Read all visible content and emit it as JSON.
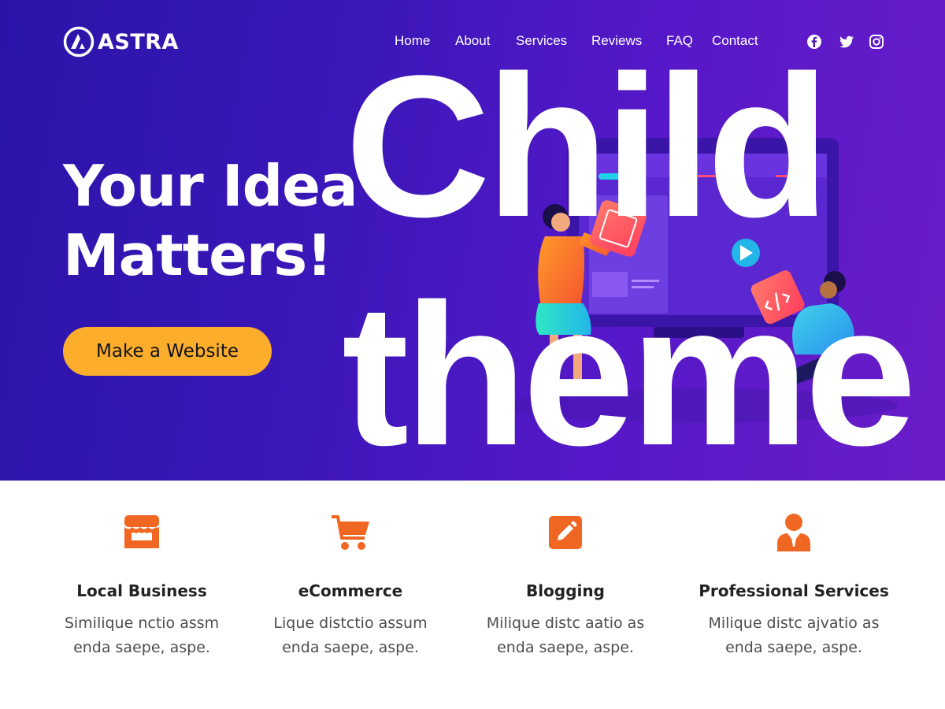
{
  "brand": {
    "name": "ASTRA"
  },
  "nav": {
    "items": [
      {
        "label": "Home"
      },
      {
        "label": "About"
      },
      {
        "label": "Services"
      },
      {
        "label": "Reviews"
      },
      {
        "label": "FAQ"
      },
      {
        "label": "Contact"
      }
    ]
  },
  "social": [
    "facebook-icon",
    "twitter-icon",
    "instagram-icon"
  ],
  "hero": {
    "headline_line1": "Your Idea",
    "headline_line2": "Matters!",
    "cta_label": "Make a Website"
  },
  "overlay": {
    "line1": "Child",
    "line2": "theme"
  },
  "features": [
    {
      "icon": "store-icon",
      "title": "Local Business",
      "desc_line1": "Similique nctio assm",
      "desc_line2": "enda saepe, aspe."
    },
    {
      "icon": "cart-icon",
      "title": "eCommerce",
      "desc_line1": "Lique distctio assum",
      "desc_line2": "enda saepe, aspe."
    },
    {
      "icon": "edit-icon",
      "title": "Blogging",
      "desc_line1": "Milique distc aatio as",
      "desc_line2": "enda saepe, aspe."
    },
    {
      "icon": "person-tie-icon",
      "title": "Professional Services",
      "desc_line1": "Milique distc ajvatio as",
      "desc_line2": "enda saepe, aspe."
    }
  ],
  "colors": {
    "accent": "#fbad2b",
    "icon_orange": "#f06723",
    "hero_start": "#2a14a8",
    "hero_end": "#6b1cc8"
  }
}
